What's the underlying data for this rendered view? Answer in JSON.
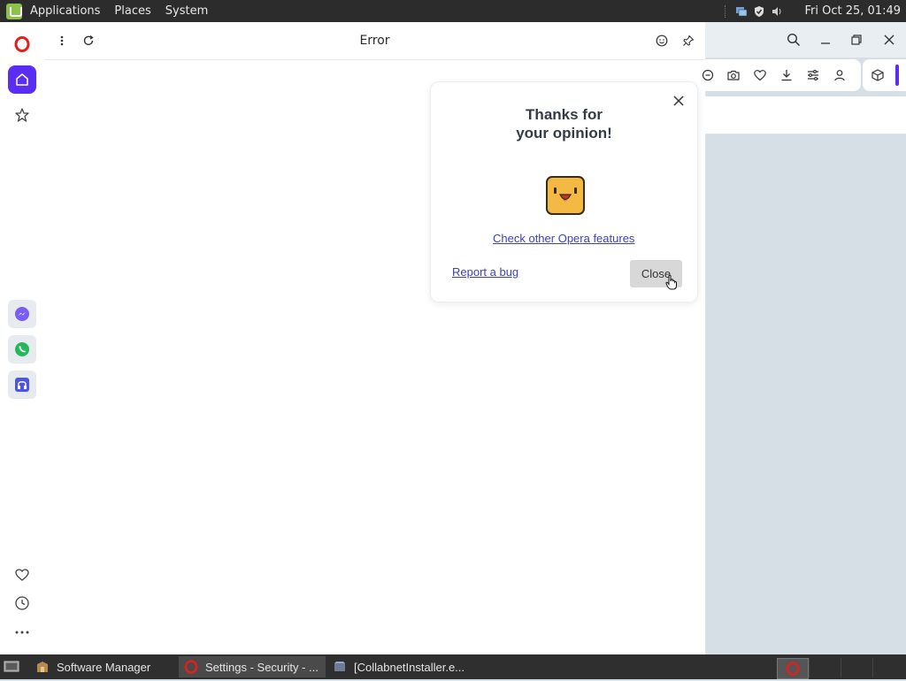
{
  "top_panel": {
    "menus": [
      "Applications",
      "Places",
      "System"
    ],
    "clock": "Fri Oct 25, 01:49"
  },
  "left_panel": {
    "title": "Error"
  },
  "popup": {
    "title": "Thanks for your opinion!",
    "features_link": "Check other Opera features",
    "report_link": "Report a bug",
    "close_button": "Close"
  },
  "taskbar": {
    "tasks": [
      "Software Manager",
      "Settings - Security - ...",
      "[CollabnetInstaller.e..."
    ]
  },
  "colors": {
    "accent": "#5a2df2",
    "opera_red": "#e0201f",
    "link": "#3b3fbf"
  }
}
